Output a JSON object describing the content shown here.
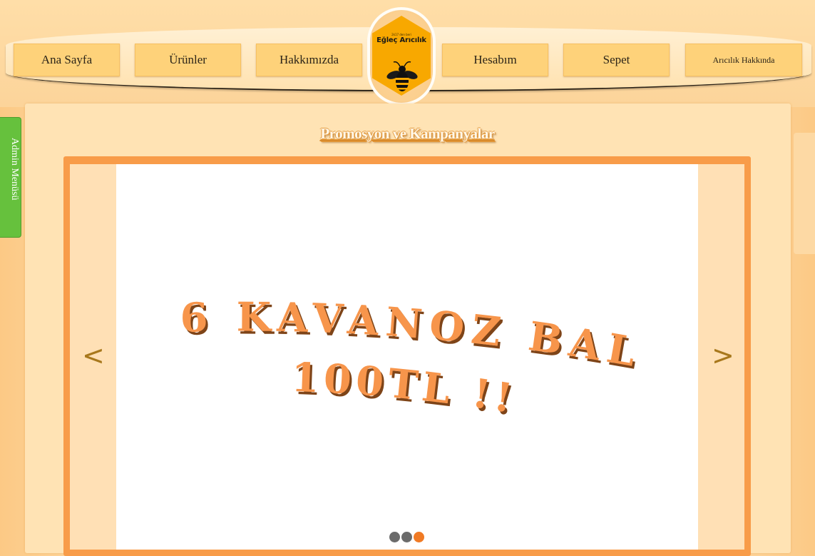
{
  "nav": {
    "items": [
      {
        "label": "Ana Sayfa"
      },
      {
        "label": "Ürünler"
      },
      {
        "label": "Hakkımızda"
      },
      {
        "label": "Hesabım"
      },
      {
        "label": "Sepet"
      },
      {
        "label": "Arıcılık Hakkında"
      }
    ]
  },
  "logo": {
    "tagline": "2k17 den beri",
    "name": "Eğleç Arıcılık"
  },
  "promo": {
    "title": "Promosyon ve Kampanyalar",
    "slide_line1": "6 KAVANOZ BAL",
    "slide_line2": "100TL !!!",
    "prev_arrow": "<",
    "next_arrow": ">",
    "dots": {
      "count": 3,
      "active_index": 2
    }
  },
  "side": {
    "admin_menu_label": "Admin Menüsü",
    "right_tab_label": ""
  },
  "colors": {
    "accent_orange": "#f89c49",
    "nav_button": "#fed27a",
    "admin_green": "#66c13d",
    "logo_hex": "#f8a800",
    "promo_text": "#f7954b",
    "promo_shadow": "#7e4418",
    "dot_inactive": "#6b6b6b",
    "dot_active": "#f07a24"
  }
}
